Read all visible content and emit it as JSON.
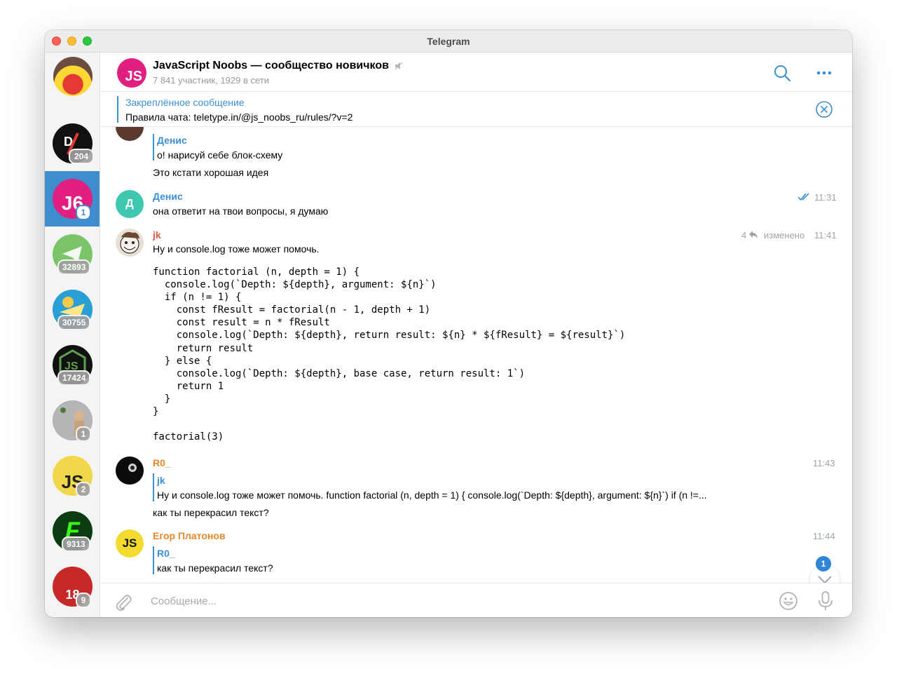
{
  "window": {
    "title": "Telegram"
  },
  "sidebar": {
    "chats": [
      {
        "id": "chat-1",
        "badge": "204",
        "avatar_bg": "#111111",
        "avatar_text": "D"
      },
      {
        "id": "chat-2",
        "badge": "1",
        "avatar_bg": "#e01f80",
        "avatar_text": "J6",
        "active": true
      },
      {
        "id": "chat-3",
        "badge": "32893",
        "avatar_bg": "#7cc46a",
        "avatar_text": ""
      },
      {
        "id": "chat-4",
        "badge": "30755",
        "avatar_bg": "#2a9fd6",
        "avatar_text": ""
      },
      {
        "id": "chat-5",
        "badge": "17424",
        "avatar_bg": "#111111",
        "avatar_text": "JS"
      },
      {
        "id": "chat-6",
        "badge": "1",
        "avatar_bg": "#8f8f8f",
        "avatar_text": ""
      },
      {
        "id": "chat-7",
        "badge": "2",
        "avatar_bg": "#f0d84a",
        "avatar_text": "JS"
      },
      {
        "id": "chat-8",
        "badge": "9313",
        "avatar_bg": "#0c3d12",
        "avatar_text": "F"
      },
      {
        "id": "chat-9",
        "badge": "9",
        "avatar_bg": "#c62828",
        "avatar_text": "18"
      }
    ]
  },
  "header": {
    "avatar_text": "JS",
    "title": "JavaScript Noobs — сообщество новичков",
    "subtitle": "7 841 участник, 1929 в сети"
  },
  "pinned": {
    "title": "Закреплённое сообщение",
    "text": "Правила чата: teletype.in/@js_noobs_ru/rules/?v=2"
  },
  "messages": {
    "m1": {
      "reply_name": "Денис",
      "reply_text": "о! нарисуй себе блок-схему",
      "text": "Это кстати хорошая идея"
    },
    "m2": {
      "sender": "Денис",
      "avatar_text": "Д",
      "text": "она ответит на твои вопросы, я думаю",
      "time": "11:31"
    },
    "m3": {
      "sender": "jk",
      "text": "Ну и console.log тоже может помочь.",
      "replies": "4",
      "edited": "изменено",
      "time": "11:41",
      "code": "function factorial (n, depth = 1) {\n  console.log(`Depth: ${depth}, argument: ${n}`)\n  if (n != 1) {\n    const fResult = factorial(n - 1, depth + 1)\n    const result = n * fResult\n    console.log(`Depth: ${depth}, return result: ${n} * ${fResult} = ${result}`)\n    return result\n  } else {\n    console.log(`Depth: ${depth}, base case, return result: 1`)\n    return 1\n  }\n}\n\nfactorial(3)"
    },
    "m4": {
      "sender": "R0_",
      "time": "11:43",
      "reply_name": "jk",
      "reply_text": "Ну и console.log тоже может помочь.  function factorial (n, depth = 1) {   console.log(`Depth: ${depth}, argument: ${n}`)   if (n !=...",
      "text": "как ты перекрасил текст?"
    },
    "m5": {
      "sender": "Егор Платонов",
      "avatar_text": "JS",
      "time": "11:44",
      "reply_name": "R0_",
      "reply_text": "как ты перекрасил текст?"
    }
  },
  "scroll_down": {
    "badge": "1"
  },
  "composer": {
    "placeholder": "Сообщение..."
  },
  "colors": {
    "accent": "#3b8fd4",
    "sender_denis": "#3b8fd4",
    "sender_jk": "#e5574a",
    "sender_r0": "#e8862a",
    "sender_egor": "#e8862a"
  }
}
